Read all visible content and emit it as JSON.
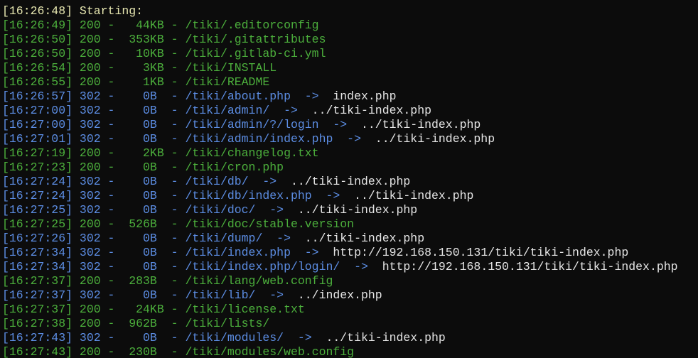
{
  "colors": {
    "background": "#0c0c0c",
    "yellow": "#e6e6b0",
    "green": "#4caf3c",
    "blue": "#5c8de3",
    "white": "#e6e6e6"
  },
  "lines": [
    [
      {
        "t": "[16:26:48] Starting:",
        "c": "yellow"
      }
    ],
    [
      {
        "t": "[16:26:49] 200 -   44KB - /tiki/.editorconfig",
        "c": "green"
      }
    ],
    [
      {
        "t": "[16:26:50] 200 -  353KB - /tiki/.gitattributes",
        "c": "green"
      }
    ],
    [
      {
        "t": "[16:26:50] 200 -   10KB - /tiki/.gitlab-ci.yml",
        "c": "green"
      }
    ],
    [
      {
        "t": "[16:26:54] 200 -    3KB - /tiki/INSTALL",
        "c": "green"
      }
    ],
    [
      {
        "t": "[16:26:55] 200 -    1KB - /tiki/README",
        "c": "green"
      }
    ],
    [
      {
        "t": "[16:26:57] 302 -    0B  - /tiki/about.php  ->",
        "c": "blue"
      },
      {
        "t": "  index.php",
        "c": "white"
      }
    ],
    [
      {
        "t": "[16:27:00] 302 -    0B  - /tiki/admin/  ->",
        "c": "blue"
      },
      {
        "t": "  ../tiki-index.php",
        "c": "white"
      }
    ],
    [
      {
        "t": "[16:27:00] 302 -    0B  - /tiki/admin/?/login  ->",
        "c": "blue"
      },
      {
        "t": "  ../tiki-index.php",
        "c": "white"
      }
    ],
    [
      {
        "t": "[16:27:01] 302 -    0B  - /tiki/admin/index.php  ->",
        "c": "blue"
      },
      {
        "t": "  ../tiki-index.php",
        "c": "white"
      }
    ],
    [
      {
        "t": "[16:27:19] 200 -    2KB - /tiki/changelog.txt",
        "c": "green"
      }
    ],
    [
      {
        "t": "[16:27:23] 200 -    0B  - /tiki/cron.php",
        "c": "green"
      }
    ],
    [
      {
        "t": "[16:27:24] 302 -    0B  - /tiki/db/  ->",
        "c": "blue"
      },
      {
        "t": "  ../tiki-index.php",
        "c": "white"
      }
    ],
    [
      {
        "t": "[16:27:24] 302 -    0B  - /tiki/db/index.php  ->",
        "c": "blue"
      },
      {
        "t": "  ../tiki-index.php",
        "c": "white"
      }
    ],
    [
      {
        "t": "[16:27:25] 302 -    0B  - /tiki/doc/  ->",
        "c": "blue"
      },
      {
        "t": "  ../tiki-index.php",
        "c": "white"
      }
    ],
    [
      {
        "t": "[16:27:25] 200 -  526B  - /tiki/doc/stable.version",
        "c": "green"
      }
    ],
    [
      {
        "t": "[16:27:26] 302 -    0B  - /tiki/dump/  ->",
        "c": "blue"
      },
      {
        "t": "  ../tiki-index.php",
        "c": "white"
      }
    ],
    [
      {
        "t": "[16:27:34] 302 -    0B  - /tiki/index.php  ->",
        "c": "blue"
      },
      {
        "t": "  http://192.168.150.131/tiki/tiki-index.php",
        "c": "white"
      }
    ],
    [
      {
        "t": "[16:27:34] 302 -    0B  - /tiki/index.php/login/  ->",
        "c": "blue"
      },
      {
        "t": "  http://192.168.150.131/tiki/tiki-index.php",
        "c": "white"
      }
    ],
    [
      {
        "t": "[16:27:37] 200 -  283B  - /tiki/lang/web.config",
        "c": "green"
      }
    ],
    [
      {
        "t": "[16:27:37] 302 -    0B  - /tiki/lib/  ->",
        "c": "blue"
      },
      {
        "t": "  ../index.php",
        "c": "white"
      }
    ],
    [
      {
        "t": "[16:27:37] 200 -   24KB - /tiki/license.txt",
        "c": "green"
      }
    ],
    [
      {
        "t": "[16:27:38] 200 -  962B  - /tiki/lists/",
        "c": "green"
      }
    ],
    [
      {
        "t": "[16:27:43] 302 -    0B  - /tiki/modules/  ->",
        "c": "blue"
      },
      {
        "t": "  ../tiki-index.php",
        "c": "white"
      }
    ],
    [
      {
        "t": "[16:27:43] 200 -  230B  - /tiki/modules/web.config",
        "c": "green"
      }
    ]
  ]
}
